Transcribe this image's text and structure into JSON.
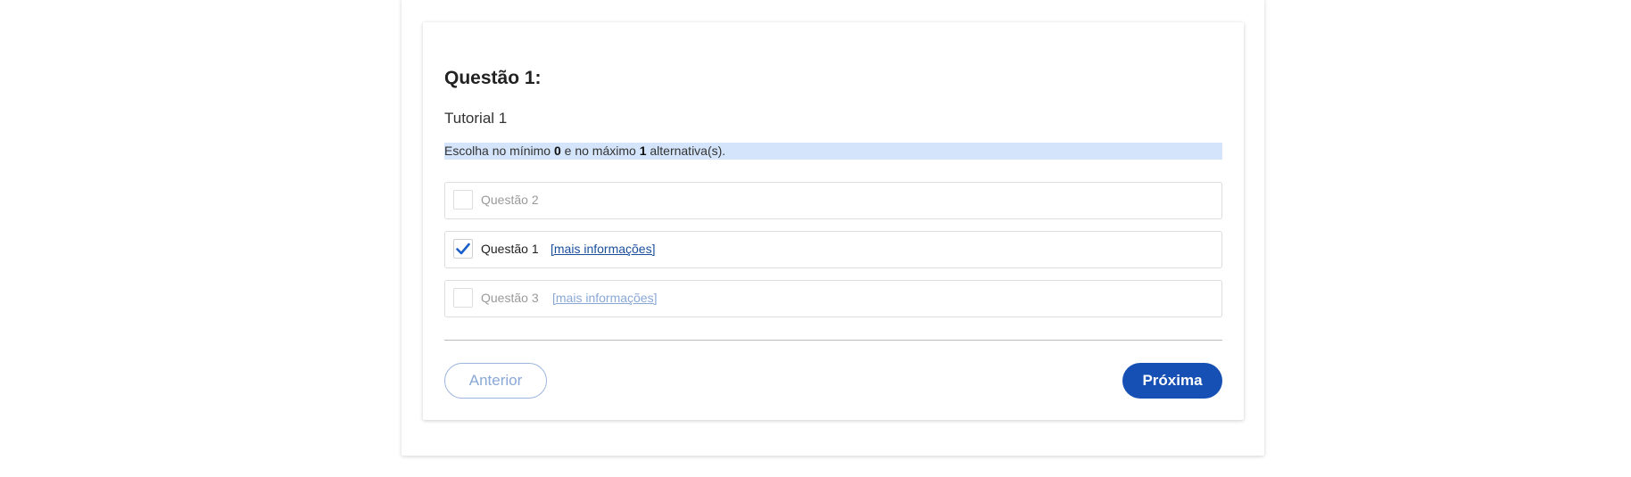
{
  "question": {
    "title": "Questão 1:",
    "subtitle": "Tutorial 1"
  },
  "hint": {
    "prefix": "Escolha no mínimo ",
    "min": "0",
    "middle": " e no máximo ",
    "max": "1",
    "suffix": " alternativa(s)."
  },
  "options": [
    {
      "label": "Questão 2",
      "checked": false,
      "more_info": ""
    },
    {
      "label": "Questão 1",
      "checked": true,
      "more_info": "[mais informações]"
    },
    {
      "label": "Questão 3",
      "checked": false,
      "more_info": "[mais informações]"
    }
  ],
  "buttons": {
    "previous": "Anterior",
    "next": "Próxima"
  },
  "colors": {
    "primary": "#1650b4",
    "hint_background": "#d3e4fb",
    "link": "#1a4f9c",
    "disabled_link": "#8aa8d6",
    "check": "#1a5fc8"
  },
  "icons": {
    "check": "check-icon"
  }
}
